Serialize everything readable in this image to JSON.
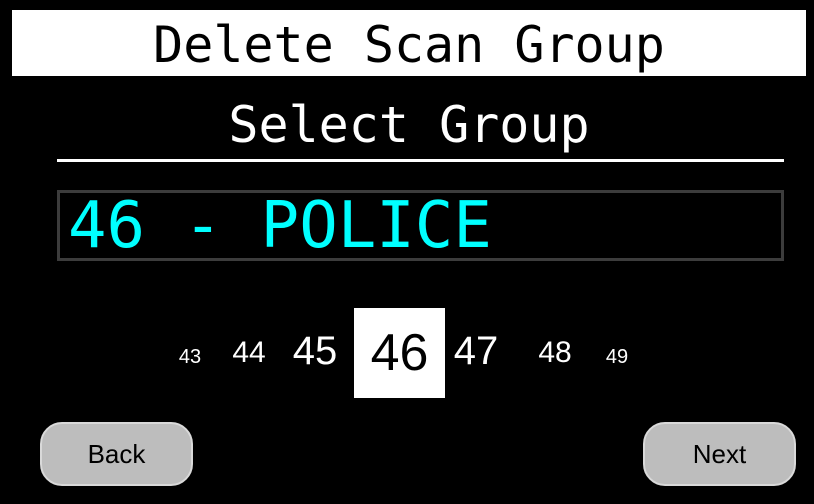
{
  "header": {
    "title": "Delete Scan Group"
  },
  "subtitle": "Select Group",
  "selection": {
    "value": "46 - POLICE"
  },
  "picker": {
    "numbers": [
      "43",
      "44",
      "45",
      "46",
      "47",
      "48",
      "49"
    ],
    "current": "46"
  },
  "buttons": {
    "back": "Back",
    "next": "Next"
  },
  "colors": {
    "background": "#000000",
    "title_bg": "#ffffff",
    "selected_text": "#00ffff",
    "button_bg": "#bdbdbd"
  }
}
